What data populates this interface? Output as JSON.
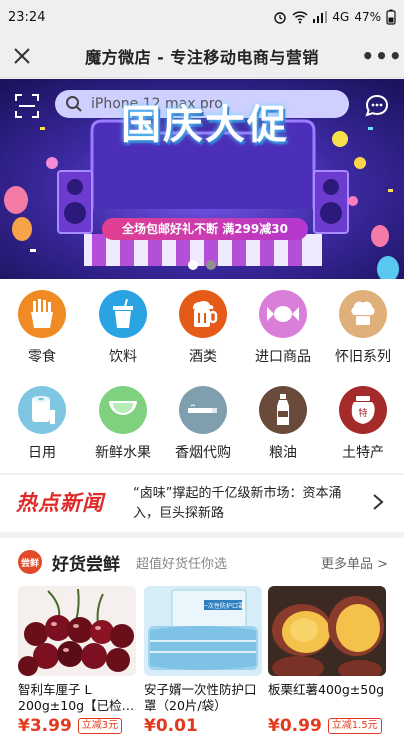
{
  "status_bar": {
    "time": "23:24",
    "network": "4G",
    "battery": "47%"
  },
  "titlebar": {
    "close_icon": "close-icon",
    "title": "魔方微店 - 专注移动电商与营销",
    "more_label": "•••"
  },
  "search": {
    "placeholder": "iPhone 12 max pro"
  },
  "banner": {
    "title": "国庆大促",
    "subtitle": "全场包邮好礼不断 满299减30",
    "slides": 2,
    "active_slide": 1
  },
  "categories": [
    {
      "label": "零食",
      "icon": "fries-icon",
      "color": "#f08a24"
    },
    {
      "label": "饮料",
      "icon": "drink-cup-icon",
      "color": "#2aa3e3"
    },
    {
      "label": "酒类",
      "icon": "beer-icon",
      "color": "#e65a18"
    },
    {
      "label": "进口商品",
      "icon": "candy-icon",
      "color": "#d97fd9"
    },
    {
      "label": "怀旧系列",
      "icon": "chef-hat-icon",
      "color": "#e0b07a"
    },
    {
      "label": "日用",
      "icon": "tissue-roll-icon",
      "color": "#7fc6e3"
    },
    {
      "label": "新鲜水果",
      "icon": "watermelon-icon",
      "color": "#7fd07f"
    },
    {
      "label": "香烟代购",
      "icon": "cigarette-icon",
      "color": "#7f9fae"
    },
    {
      "label": "粮油",
      "icon": "oil-bottle-icon",
      "color": "#6a4a3a"
    },
    {
      "label": "土特产",
      "icon": "jar-icon",
      "color": "#a52a2a"
    }
  ],
  "news": {
    "tag": "热点新闻",
    "text": "“卤味”撑起的千亿级新市场：资本涌入，巨头探新路"
  },
  "goods": {
    "badge": "尝鲜",
    "title": "好货尝鲜",
    "subtitle": "超值好货任你选",
    "more": "更多单品 >",
    "items": [
      {
        "name": "智利车厘子 L 200g±10g【已检…",
        "price": "¥3.99",
        "discount": "立减3元",
        "image": "cherries-image"
      },
      {
        "name": "安子婿一次性防护口罩（20片/袋）",
        "price": "¥0.01",
        "discount": "",
        "image": "face-mask-image"
      },
      {
        "name": "板栗红薯400g±50g",
        "price": "¥0.99",
        "discount": "立减1.5元",
        "image": "sweet-potato-image"
      }
    ]
  }
}
